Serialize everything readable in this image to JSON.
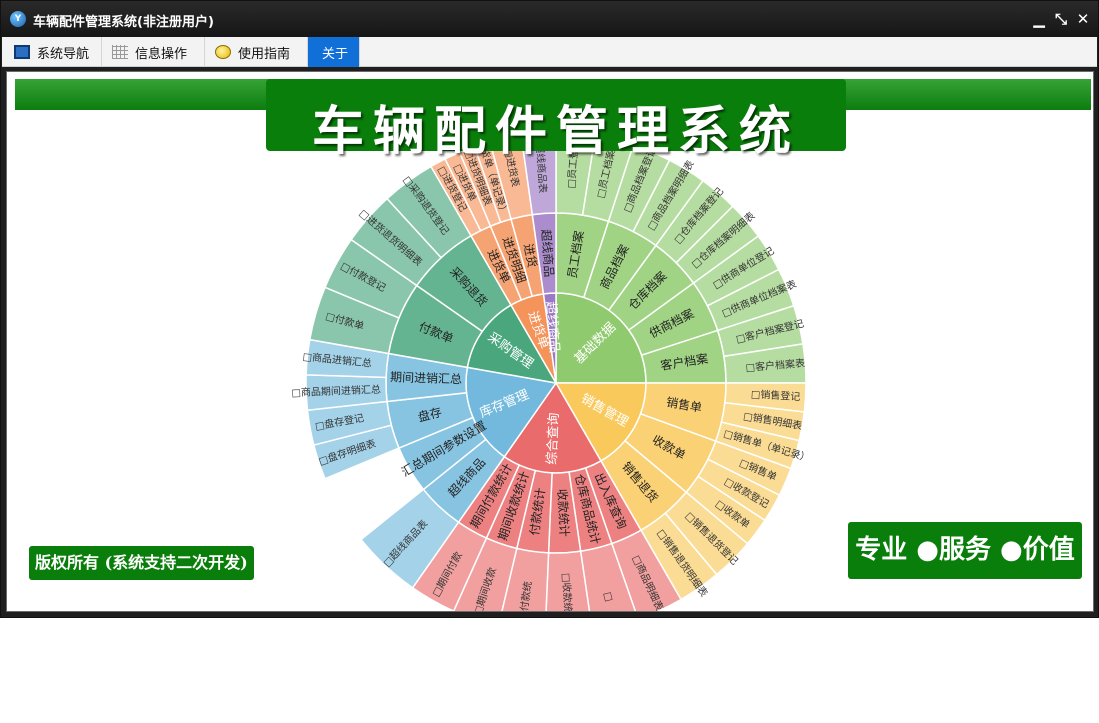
{
  "window": {
    "title": "车辆配件管理系统(非注册用户)",
    "icon": "app-logo-icon"
  },
  "controls": {
    "minimize": "▁",
    "restore": "⤡",
    "close": "✕"
  },
  "menu": {
    "tabs": [
      {
        "label": "系统导航",
        "icon": "monitor-icon"
      },
      {
        "label": "信息操作",
        "icon": "grid-icon"
      },
      {
        "label": "使用指南",
        "icon": "lightbulb-icon"
      },
      {
        "label": "关于",
        "icon": ""
      }
    ],
    "active": "关于"
  },
  "banner": {
    "title": "车辆配件管理系统"
  },
  "copyright": "版权所有 (系统支持二次开发)",
  "slogan": "专业 ●服务 ●价值",
  "colors": {
    "banner_green": "#0a7e0b",
    "tab_active": "#1070d8",
    "basic": "#8fcb6e",
    "sales": "#f9c95c",
    "query": "#ea6b6b",
    "inventory": "#72b9dd",
    "purchase": "#4aa77d",
    "incoming": "#f4935a",
    "overline": "#9c79c5"
  },
  "sunburst": [
    {
      "name": "基础数据",
      "color": "#8fcb6e",
      "children": [
        {
          "name": "员工档案",
          "children": [
            "□员工登记",
            "□员工档案表"
          ]
        },
        {
          "name": "商品档案",
          "children": [
            "□商品档案登记",
            "□商品档案明细表"
          ]
        },
        {
          "name": "仓库档案",
          "children": [
            "□仓库档案登记",
            "□仓库档案明细表"
          ]
        },
        {
          "name": "供商档案",
          "children": [
            "□供商单位登记",
            "□供商单位档案表"
          ]
        },
        {
          "name": "客户档案",
          "children": [
            "□客户档案登记",
            "□客户档案表"
          ]
        }
      ]
    },
    {
      "name": "销售管理",
      "color": "#f9c95c",
      "children": [
        {
          "name": "销售单",
          "children": [
            "□销售登记",
            "□销售明细表",
            "□销售单（单记录）"
          ]
        },
        {
          "name": "收款单",
          "children": [
            "□销售单",
            "□收款登记",
            "□收款单"
          ]
        },
        {
          "name": "销售退货",
          "children": [
            "□销售退货登记",
            "□销售退货明细表"
          ]
        }
      ]
    },
    {
      "name": "综合查询",
      "color": "#ea6b6b",
      "children": [
        {
          "name": "出入库查询",
          "children": [
            "□商品明细表"
          ]
        },
        {
          "name": "仓库商品统计",
          "children": [
            "□"
          ]
        },
        {
          "name": "收款统计",
          "children": [
            "□收款统计表"
          ]
        },
        {
          "name": "付款统计",
          "children": [
            "□付款统"
          ]
        },
        {
          "name": "期间收款统计",
          "children": [
            "□期间收款"
          ]
        },
        {
          "name": "期间付款统计",
          "children": [
            "□期间付款"
          ]
        }
      ]
    },
    {
      "name": "库存管理",
      "color": "#72b9dd",
      "children": [
        {
          "name": "超线商品",
          "children": [
            "□超线商品表"
          ]
        },
        {
          "name": "汇总期间参数设置",
          "children": []
        },
        {
          "name": "盘存",
          "children": [
            "□盘存明细表",
            "□盘存登记"
          ]
        },
        {
          "name": "期间进销汇总",
          "children": [
            "□商品期间进销汇总",
            "□商品进销汇总"
          ]
        }
      ]
    },
    {
      "name": "采购管理",
      "color": "#4aa77d",
      "children": [
        {
          "name": "付款单",
          "children": [
            "□付款单",
            "□付款登记"
          ]
        },
        {
          "name": "采购退货",
          "children": [
            "□进货退货明细表",
            "□采购退货登记"
          ]
        }
      ]
    },
    {
      "name": "进货单",
      "color": "#f4935a",
      "children": [
        {
          "name": "进货单",
          "children": [
            "□进货登记",
            "□进货单"
          ]
        },
        {
          "name": "进货明细",
          "children": [
            "□进货明细表",
            "□进货单（单记录）"
          ]
        },
        {
          "name": "进货",
          "children": [
            "□进货表"
          ]
        }
      ]
    },
    {
      "name": "超线商品",
      "color": "#9c79c5",
      "children": [
        {
          "name": "超线商品",
          "children": [
            "□超线商品表"
          ]
        }
      ]
    }
  ]
}
